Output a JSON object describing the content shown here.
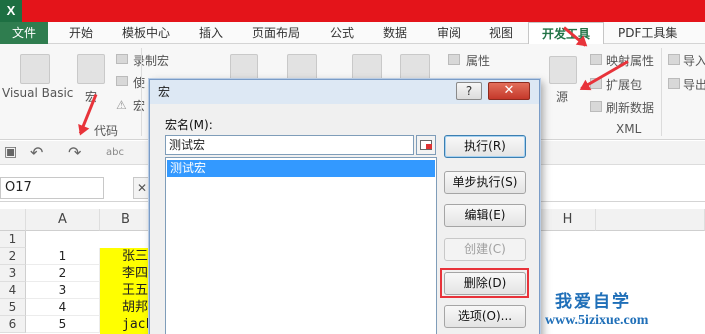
{
  "app": {
    "logo": "X",
    "logo_sub": "≡"
  },
  "tabs": [
    "文件",
    "开始",
    "模板中心",
    "插入",
    "页面布局",
    "公式",
    "数据",
    "审阅",
    "视图",
    "开发工具",
    "PDF工具集"
  ],
  "active_tab": "开发工具",
  "ribbon": {
    "visual_basic": "Visual Basic",
    "macro": "宏",
    "record_macro": "录制宏",
    "use_relative": "使",
    "macro_security": "宏",
    "group_code": "代码",
    "source": "源",
    "map_props": "映射属性",
    "import": "导入",
    "ext_pack": "扩展包",
    "export": "导出",
    "refresh_data": "刷新数据",
    "group_xml": "XML",
    "properties": "属性"
  },
  "name_box": "O17",
  "columns": [
    "A",
    "B",
    "H"
  ],
  "rows": [
    {
      "n": "1",
      "a": "",
      "b": ""
    },
    {
      "n": "2",
      "a": "1",
      "b": "张三"
    },
    {
      "n": "3",
      "a": "2",
      "b": "李四"
    },
    {
      "n": "4",
      "a": "3",
      "b": "王五"
    },
    {
      "n": "5",
      "a": "4",
      "b": "胡邦君"
    },
    {
      "n": "6",
      "a": "5",
      "b": "jackwu"
    }
  ],
  "dialog": {
    "title": "宏",
    "help": "?",
    "close": "✕",
    "name_label": "宏名(M):",
    "name_value": "测试宏",
    "list_items": [
      "测试宏"
    ],
    "buttons": {
      "run": "执行(R)",
      "step": "单步执行(S)",
      "edit": "编辑(E)",
      "create": "创建(C)",
      "delete": "删除(D)",
      "options": "选项(O)..."
    }
  },
  "watermark": {
    "line1": "我爱自学",
    "line2": "www.5izixue.com"
  },
  "colors": {
    "titlebar": "#e4141a",
    "highlight_box": "#e8333a",
    "selection": "#3399ff",
    "cell_fill": "#ffff00"
  }
}
